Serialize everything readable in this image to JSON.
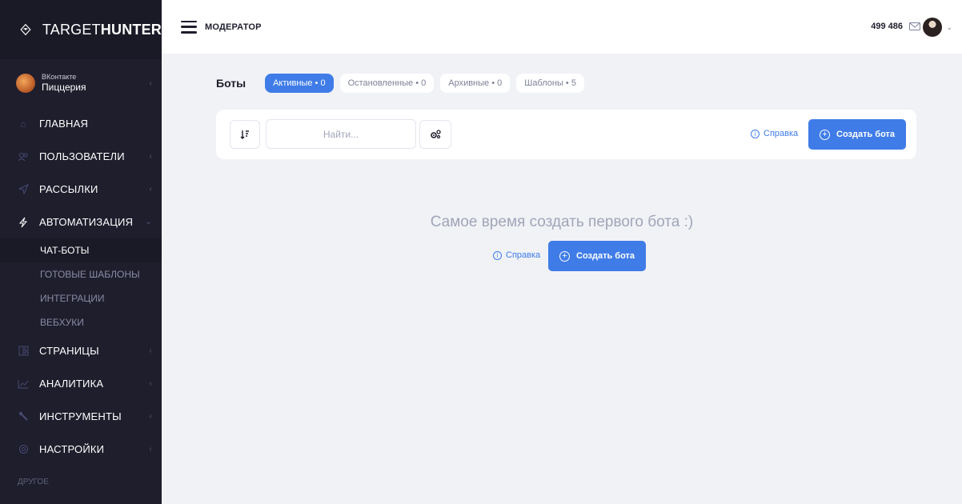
{
  "logo": {
    "text_light": "TARGET",
    "text_bold": "HUNTER"
  },
  "account": {
    "network": "ВКонтакте",
    "name": "Пиццерия"
  },
  "nav": {
    "home": "ГЛАВНАЯ",
    "users": "ПОЛЬЗОВАТЕЛИ",
    "mailings": "РАССЫЛКИ",
    "automation": "АВТОМАТИЗАЦИЯ",
    "sub": {
      "chatbots": "ЧАТ-БОТЫ",
      "templates": "ГОТОВЫЕ ШАБЛОНЫ",
      "integrations": "ИНТЕГРАЦИИ",
      "webhooks": "ВЕБХУКИ"
    },
    "pages": "СТРАНИЦЫ",
    "analytics": "АНАЛИТИКА",
    "tools": "ИНСТРУМЕНТЫ",
    "settings": "НАСТРОЙКИ",
    "other": "ДРУГОЕ"
  },
  "header": {
    "title": "МОДЕРАТОР",
    "balance": "499 486"
  },
  "main": {
    "title": "Боты",
    "tabs": [
      {
        "label": "Активные • 0"
      },
      {
        "label": "Остановленные • 0"
      },
      {
        "label": "Архивные • 0"
      },
      {
        "label": "Шаблоны • 5"
      }
    ],
    "search_placeholder": "Найти...",
    "help_label": "Справка",
    "create_label": "Создать бота",
    "empty_text": "Самое время создать первого бота :)"
  },
  "colors": {
    "accent": "#3f7ce8",
    "sidebar": "#1e1e2d",
    "background": "#f0f2f6"
  }
}
